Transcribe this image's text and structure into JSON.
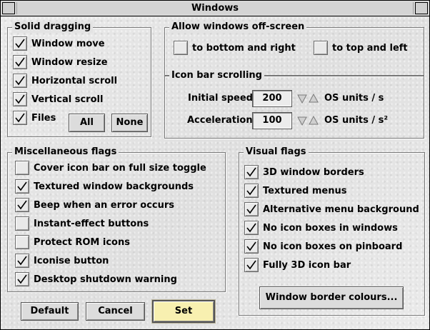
{
  "window": {
    "title": "Windows"
  },
  "solid_dragging": {
    "label": "Solid dragging",
    "items": [
      {
        "label": "Window move",
        "checked": true
      },
      {
        "label": "Window resize",
        "checked": true
      },
      {
        "label": "Horizontal scroll",
        "checked": true
      },
      {
        "label": "Vertical scroll",
        "checked": true
      },
      {
        "label": "Files",
        "checked": true
      }
    ],
    "all_label": "All",
    "none_label": "None"
  },
  "offscreen": {
    "label": "Allow windows off-screen",
    "items": [
      {
        "label": "to bottom and right",
        "checked": false
      },
      {
        "label": "to top and left",
        "checked": false
      }
    ]
  },
  "iconbar_scrolling": {
    "label": "Icon bar scrolling",
    "speed_label": "Initial speed",
    "speed_value": "200",
    "speed_unit": "OS units / s",
    "accel_label": "Acceleration",
    "accel_value": "100",
    "accel_unit": "OS units / s²"
  },
  "misc_flags": {
    "label": "Miscellaneous flags",
    "items": [
      {
        "label": "Cover icon bar on full size toggle",
        "checked": false
      },
      {
        "label": "Textured window backgrounds",
        "checked": true
      },
      {
        "label": "Beep when an error occurs",
        "checked": true
      },
      {
        "label": "Instant-effect buttons",
        "checked": false
      },
      {
        "label": "Protect ROM icons",
        "checked": false
      },
      {
        "label": "Iconise button",
        "checked": true
      },
      {
        "label": "Desktop shutdown warning",
        "checked": true
      }
    ]
  },
  "visual_flags": {
    "label": "Visual flags",
    "items": [
      {
        "label": "3D window borders",
        "checked": true
      },
      {
        "label": "Textured menus",
        "checked": true
      },
      {
        "label": "Alternative menu background",
        "checked": true
      },
      {
        "label": "No icon boxes in windows",
        "checked": true
      },
      {
        "label": "No icon boxes on pinboard",
        "checked": true
      },
      {
        "label": "Fully 3D icon bar",
        "checked": true
      }
    ],
    "border_colours_label": "Window border colours..."
  },
  "actions": {
    "default_label": "Default",
    "cancel_label": "Cancel",
    "set_label": "Set"
  },
  "colors": {
    "set_button_bg": "#f8f0b0",
    "group_border": "#777777",
    "background": "#e3e3e3"
  }
}
